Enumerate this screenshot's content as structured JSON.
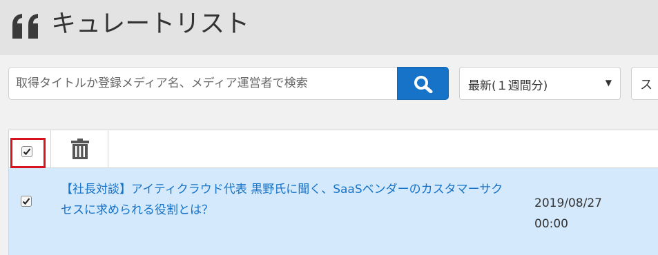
{
  "header": {
    "icon": "quote-icon",
    "title": "キュレートリスト"
  },
  "search": {
    "placeholder": "取得タイトルか登録メディア名、メディア運営者で検索",
    "value": "",
    "button_icon": "search-icon"
  },
  "filters": {
    "period_selected": "最新(１週間分)",
    "second_selected": "ス"
  },
  "table": {
    "select_all_checked": true,
    "delete_icon": "trash-icon",
    "rows": [
      {
        "checked": true,
        "title": "【社長対談】アイティクラウド代表 黒野氏に聞く、SaaSベンダーのカスタマーサクセスに求められる役割とは？",
        "date": "2019/08/27",
        "time": "00:00"
      }
    ]
  },
  "colors": {
    "accent": "#1673c8",
    "row_selected_bg": "#d4e9fb",
    "highlight_border": "#d9121f"
  }
}
